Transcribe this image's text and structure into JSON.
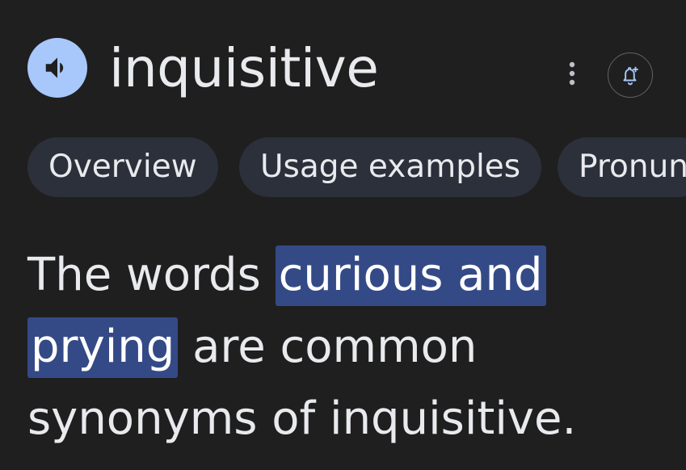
{
  "header": {
    "speaker_icon": "volume-up-icon",
    "word": "inquisitive",
    "more_icon": "more-vert-icon",
    "alert_icon": "add-alert-icon"
  },
  "tabs": [
    {
      "label": "Overview"
    },
    {
      "label": "Usage examples"
    },
    {
      "label": "Pronun"
    }
  ],
  "sentence": {
    "prefix": "The words ",
    "highlight": "curious and prying",
    "suffix": " are common synonyms of inquisitive."
  },
  "colors": {
    "background": "#1f1f1f",
    "accent": "#a8c7fa",
    "chip_background": "#2b303b",
    "highlight_background": "#344a87"
  }
}
